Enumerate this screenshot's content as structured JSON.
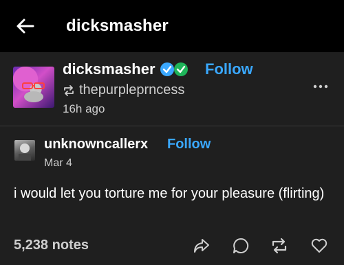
{
  "topbar": {
    "title": "dicksmasher",
    "back_icon": "arrow-left-icon"
  },
  "reblog_post": {
    "blog_name": "dicksmasher",
    "badges": [
      "verified-blue-badge",
      "verified-green-badge"
    ],
    "follow_label": "Follow",
    "reblogged_from": "thepurpleprncess",
    "time_ago": "16h ago",
    "more_icon": "more-horizontal-icon"
  },
  "original_post": {
    "author": "unknowncallerx",
    "follow_label": "Follow",
    "date": "Mar 4",
    "body": "i would let you torture me for your pleasure (flirting)"
  },
  "footer": {
    "notes": "5,238 notes",
    "actions": [
      "share-icon",
      "reply-icon",
      "reblog-icon",
      "like-icon"
    ]
  },
  "colors": {
    "background": "#1f1f1f",
    "topbar": "#000000",
    "accent_blue": "#3aa8ff",
    "badge_green": "#1fb55a"
  }
}
